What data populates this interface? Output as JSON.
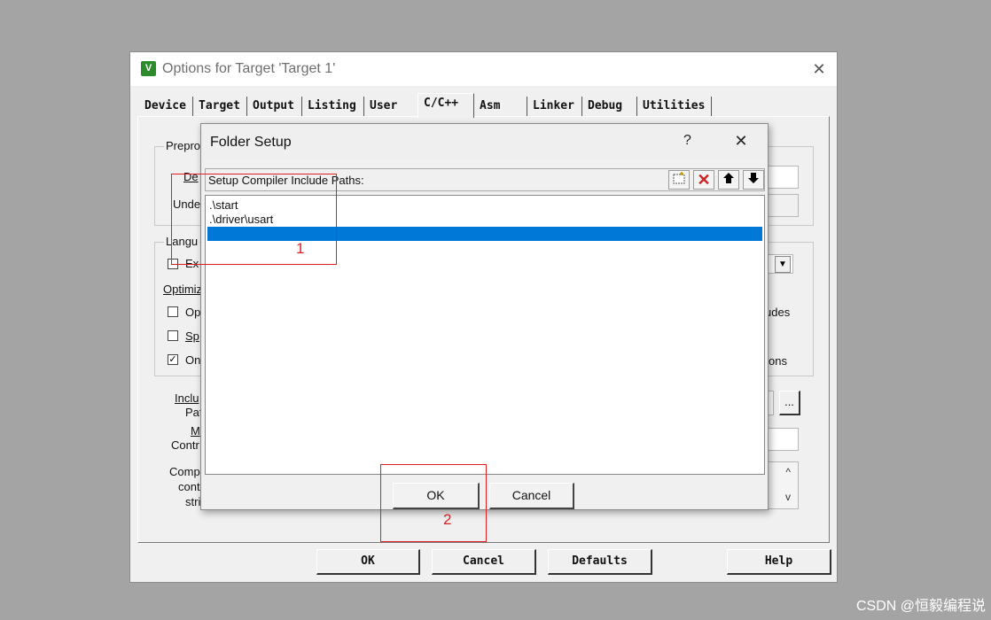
{
  "window": {
    "title": "Options for Target 'Target 1'",
    "icon": "keil-uvision-icon",
    "close_glyph": "✕"
  },
  "tabs": [
    {
      "label": "Device"
    },
    {
      "label": "Target"
    },
    {
      "label": "Output"
    },
    {
      "label": "Listing"
    },
    {
      "label": "User"
    },
    {
      "label": "C/C++",
      "active": true
    },
    {
      "label": "Asm"
    },
    {
      "label": "Linker"
    },
    {
      "label": "Debug"
    },
    {
      "label": "Utilities"
    }
  ],
  "background_fragments": {
    "preprocessor_group": "Prepro",
    "define": "De",
    "undefine": "Unde",
    "language_group": "Langu",
    "ex": "Ex",
    "optimization": "Optimiz",
    "op": "Op",
    "sp": "Sp",
    "on": "On",
    "include_1": "Inclu",
    "include_2": "Pat",
    "misc_1": "M",
    "misc_2": "Contr",
    "compiler_1": "Comp",
    "compiler_2": "cont",
    "compiler_3": "stri",
    "right_udes": "udes",
    "right_ons": "ons",
    "browse": "...",
    "dropdown_arrow": "▼",
    "scroll_up": "^",
    "scroll_down": "v"
  },
  "bottom_buttons": {
    "ok": "OK",
    "cancel": "Cancel",
    "defaults": "Defaults",
    "help": "Help"
  },
  "dialog": {
    "title": "Folder Setup",
    "help_glyph": "?",
    "close_glyph": "✕",
    "list_header": "Setup Compiler Include Paths:",
    "toolbar": {
      "new": "new-folder-icon",
      "delete": "delete-icon",
      "up": "move-up-icon",
      "down": "move-down-icon"
    },
    "paths": [
      ".\\start",
      ".\\driver\\usart",
      ""
    ],
    "selected_index": 2,
    "ok_label": "OK",
    "cancel_label": "Cancel"
  },
  "annotations": [
    {
      "label": "1",
      "color": "#e02020"
    },
    {
      "label": "2",
      "color": "#e02020"
    }
  ],
  "watermark": "CSDN @恒毅编程说"
}
